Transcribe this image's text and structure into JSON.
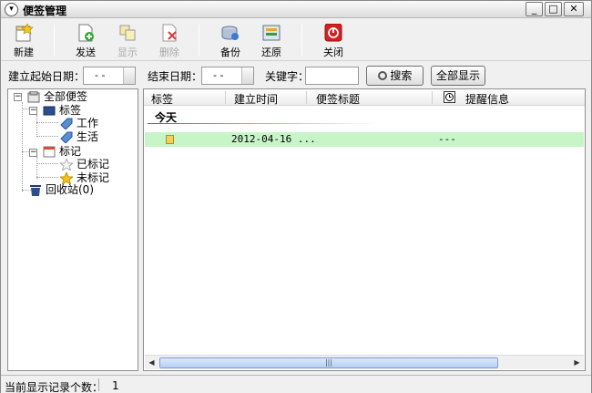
{
  "window": {
    "title": "便签管理",
    "menu_icon": "▾",
    "min": "_",
    "max": "□",
    "close": "✕"
  },
  "toolbar": {
    "new": "新建",
    "send": "发送",
    "show": "显示",
    "delete": "删除",
    "backup": "备份",
    "restore": "还原",
    "close": "关闭"
  },
  "filter": {
    "start_label": "建立起始日期：",
    "start_value": "- -",
    "end_label": "结束日期：",
    "end_value": "- -",
    "keyword_label": "关键字：",
    "keyword_value": "",
    "search": "搜索",
    "show_all": "全部显示"
  },
  "tree": {
    "root": "全部便签",
    "tags": "标签",
    "work": "工作",
    "life": "生活",
    "marks": "标记",
    "marked": "已标记",
    "unmarked": "未标记",
    "recycle": "回收站(0)"
  },
  "list": {
    "columns": [
      "标签",
      "建立时间",
      "便签标题",
      "提醒信息"
    ],
    "group": "今天",
    "rows": [
      {
        "created": "2012-04-16 ...",
        "title": "",
        "reminder": "---"
      }
    ],
    "hscroll_left": "◀",
    "hscroll_right": "▶",
    "hscroll_grip": "|||"
  },
  "status": {
    "label": "当前显示记录个数：",
    "count": "1"
  }
}
